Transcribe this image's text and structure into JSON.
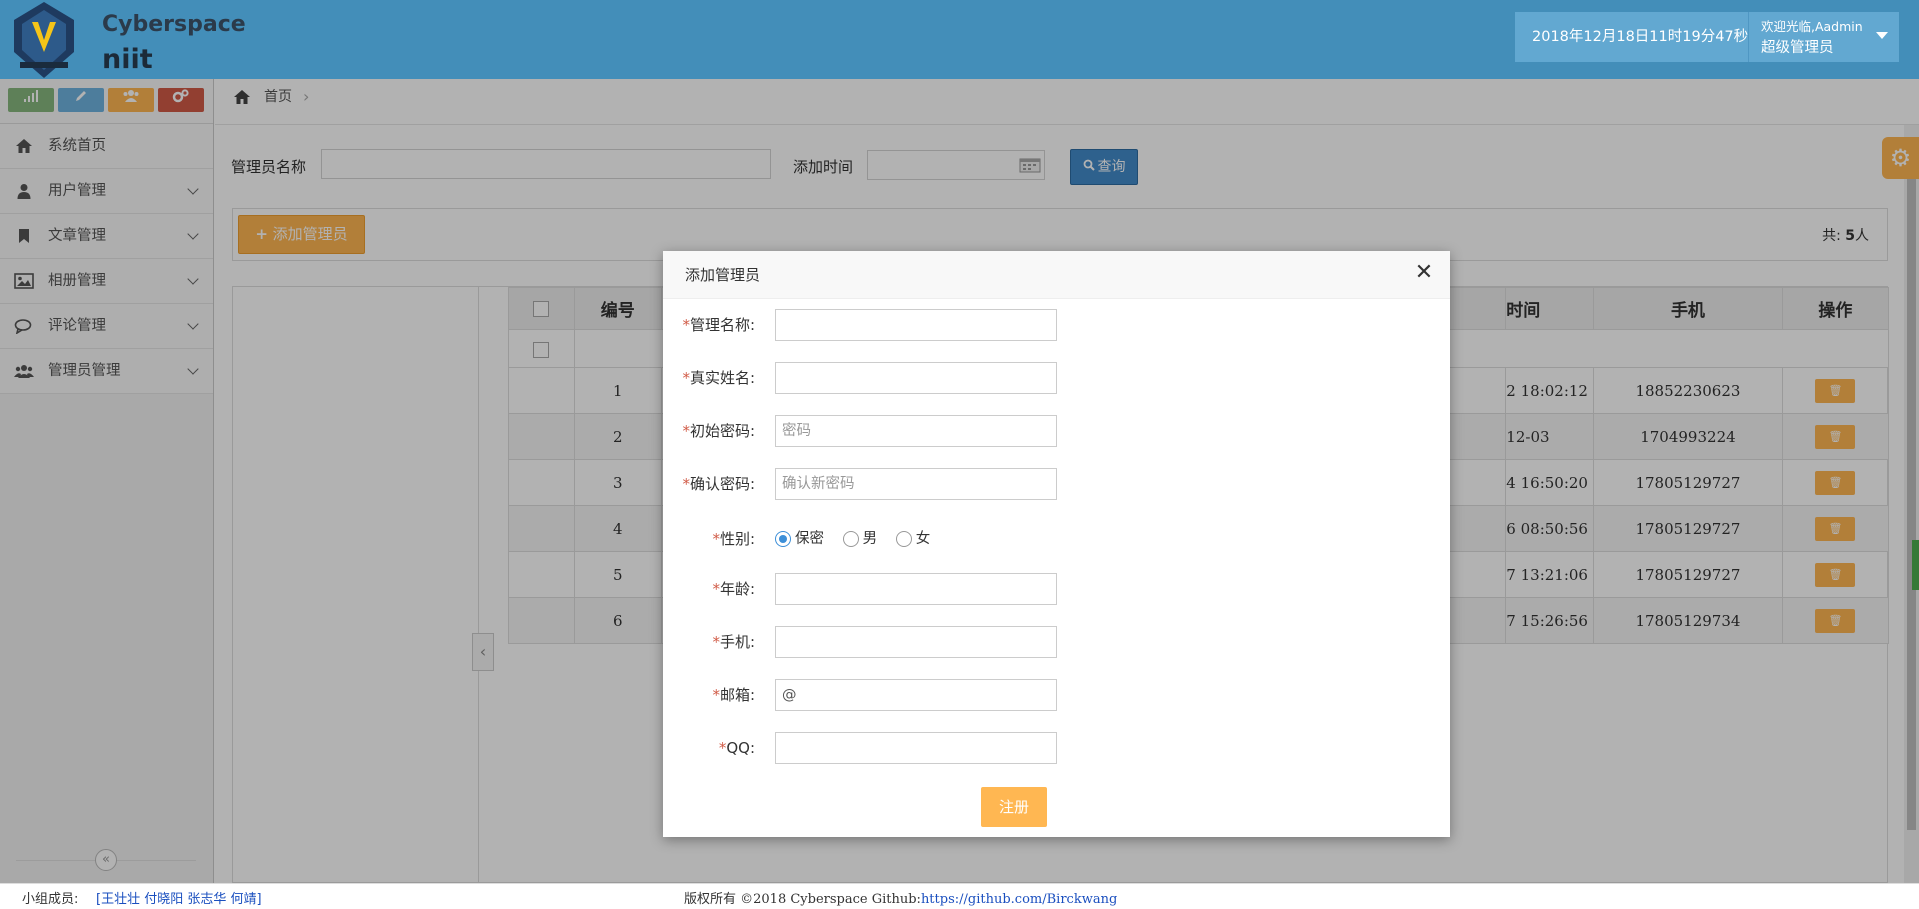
{
  "header": {
    "logo_line1": "Cyberspace",
    "logo_line2": "niit",
    "datetime": "2018年12月18日11时19分47秒",
    "welcome": "欢迎光临,Aadmin",
    "role": "超级管理员"
  },
  "shortcuts": [
    {
      "icon": "signal-icon",
      "color": "#87b87f"
    },
    {
      "icon": "pencil-icon",
      "color": "#6fb3e0"
    },
    {
      "icon": "users-icon",
      "color": "#ffb752"
    },
    {
      "icon": "cogs-icon",
      "color": "#d15b47"
    }
  ],
  "sidebar": {
    "items": [
      {
        "label": "系统首页",
        "icon": "home-icon"
      },
      {
        "label": "用户管理",
        "icon": "user-icon"
      },
      {
        "label": "文章管理",
        "icon": "bookmark-icon"
      },
      {
        "label": "相册管理",
        "icon": "picture-icon"
      },
      {
        "label": "评论管理",
        "icon": "comments-icon"
      },
      {
        "label": "管理员管理",
        "icon": "group-icon"
      }
    ],
    "collapse_glyph": "«"
  },
  "breadcrumb": {
    "home": "首页",
    "sep": "›"
  },
  "search": {
    "name_label": "管理员名称",
    "time_label": "添加时间",
    "query_label": "查询"
  },
  "toolbar": {
    "add_label": "添加管理员",
    "count_prefix": "共:",
    "count_value": "5",
    "count_suffix": "人"
  },
  "table": {
    "headers": [
      "",
      "编号",
      "",
      "时间",
      "手机",
      "操作"
    ],
    "rows": [
      {
        "id": "1",
        "time": "2 18:02:12",
        "phone": "18852230623"
      },
      {
        "id": "2",
        "time": "12-03",
        "phone": "1704993224"
      },
      {
        "id": "3",
        "time": "4 16:50:20",
        "phone": "17805129727"
      },
      {
        "id": "4",
        "time": "6 08:50:56",
        "phone": "17805129727"
      },
      {
        "id": "5",
        "time": "7 13:21:06",
        "phone": "17805129727"
      },
      {
        "id": "6",
        "time": "7 15:26:56",
        "phone": "17805129734"
      }
    ]
  },
  "modal": {
    "title": "添加管理员",
    "fields": {
      "name": {
        "label": "管理名称:",
        "value": ""
      },
      "realname": {
        "label": "真实姓名:",
        "value": ""
      },
      "password": {
        "label": "初始密码:",
        "placeholder": "密码"
      },
      "confirm": {
        "label": "确认密码:",
        "placeholder": "确认新密码"
      },
      "gender": {
        "label": "性别:",
        "options": [
          "保密",
          "男",
          "女"
        ],
        "selected": "保密"
      },
      "age": {
        "label": "年龄:",
        "value": ""
      },
      "phone": {
        "label": "手机:",
        "value": ""
      },
      "email": {
        "label": "邮箱:",
        "value": "@"
      },
      "qq": {
        "label": "QQ:",
        "value": ""
      }
    },
    "required_mark": "*",
    "submit_label": "注册"
  },
  "footer": {
    "members_label": "小组成员:",
    "members": "[王壮壮 付晓阳 张志华 何靖]",
    "copyright": "版权所有 ©2018 Cyberspace Github:",
    "github": "https://github.com/Birckwang"
  },
  "colors": {
    "header_bg": "#438eb9",
    "accent_orange": "#ffb752",
    "primary_blue": "#428bca"
  }
}
